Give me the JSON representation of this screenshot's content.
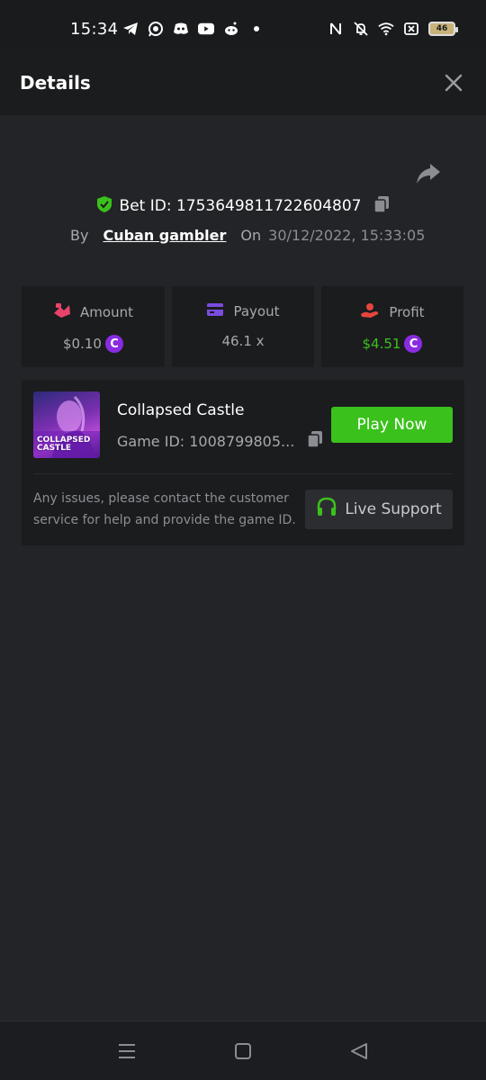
{
  "status_bar": {
    "time": "15:34",
    "battery": "46",
    "left_icons": [
      "telegram-icon",
      "whatsapp-icon",
      "discord-icon",
      "youtube-icon",
      "reddit-icon",
      "dot-icon"
    ],
    "right_icons": [
      "nfc-icon",
      "bell-muted-icon",
      "wifi-icon",
      "sim-x-icon",
      "battery-icon"
    ]
  },
  "header": {
    "title": "Details",
    "close_icon": "close-icon"
  },
  "bet": {
    "bet_id_label": "Bet ID: 1753649811722604807",
    "by_label": "By",
    "user": "Cuban gambler",
    "on_label": "On",
    "date": "30/12/2022, 15:33:05"
  },
  "stats": {
    "amount_label": "Amount",
    "amount_value": "$0.10",
    "payout_label": "Payout",
    "payout_value": "46.1 x",
    "profit_label": "Profit",
    "profit_value": "$4.51",
    "coin_symbol": "C"
  },
  "game": {
    "name": "Collapsed Castle",
    "game_id": "Game ID: 1008799805...",
    "thumb_text": "COLLAPSED\nCASTLE",
    "play_label": "Play Now",
    "issue_text": "Any issues, please contact the customer service for help and provide the game ID.",
    "support_label": "Live Support"
  },
  "colors": {
    "accent_green": "#3bc11c",
    "profit_green": "#3bc11c",
    "coin_purple": "#8a2be2",
    "amount_icon": "#e8446a",
    "payout_icon": "#7a4ce0",
    "profit_icon": "#e5453c",
    "background": "#232427",
    "card": "#1b1c1e"
  }
}
